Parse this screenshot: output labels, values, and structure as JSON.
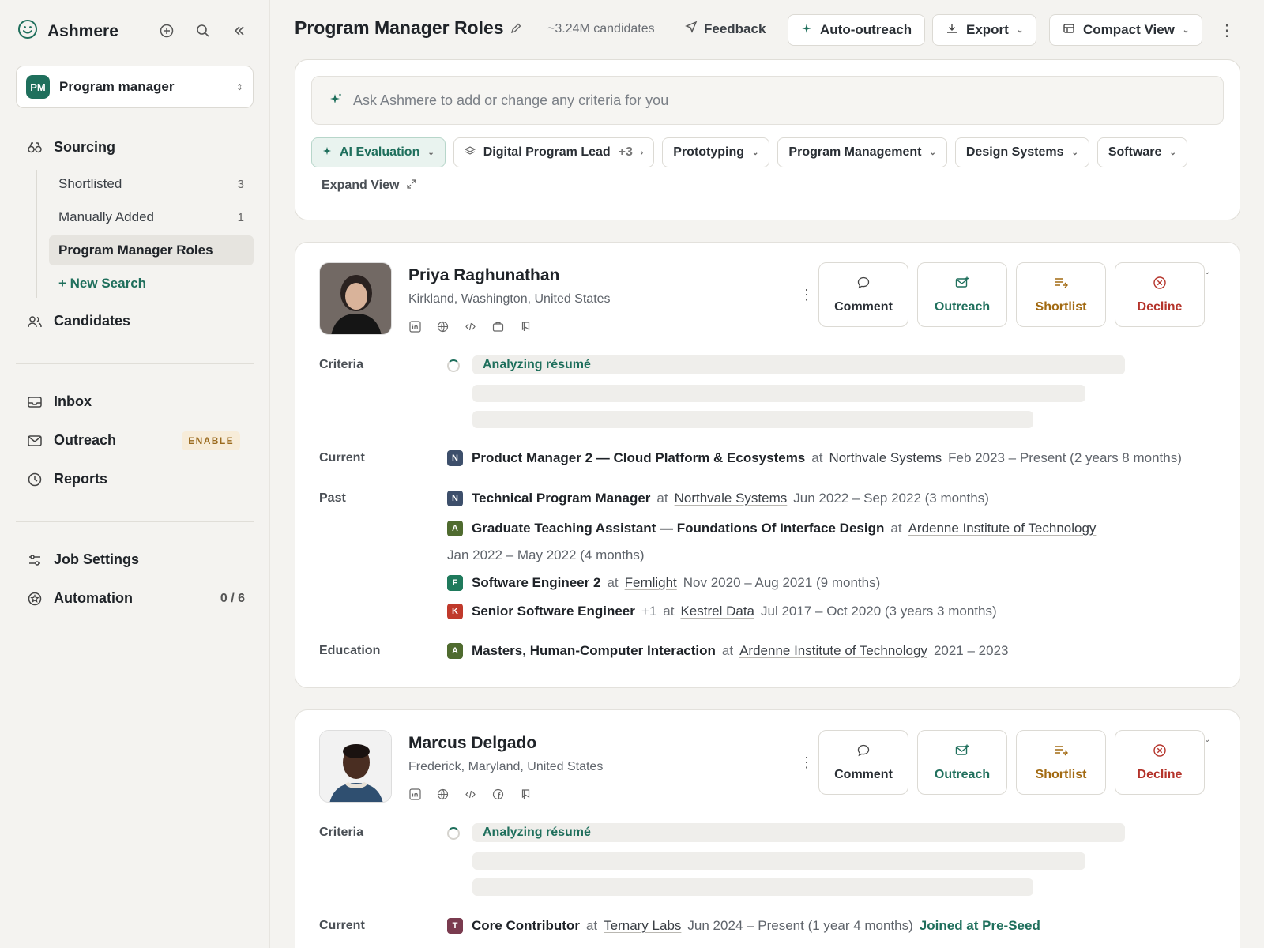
{
  "app": {
    "name": "Ashmere"
  },
  "project": {
    "badge": "PM",
    "name": "Program manager"
  },
  "sidebar": {
    "sourcing_label": "Sourcing",
    "sub_items": [
      {
        "label": "Shortlisted",
        "count": "3"
      },
      {
        "label": "Manually Added",
        "count": "1"
      },
      {
        "label": "Program Manager Roles",
        "count": ""
      },
      {
        "label": "+ New Search",
        "count": ""
      }
    ],
    "candidates_label": "Candidates",
    "inbox_label": "Inbox",
    "outreach_label": "Outreach",
    "outreach_badge": "ENABLE",
    "reports_label": "Reports",
    "job_settings_label": "Job Settings",
    "automation_label": "Automation",
    "automation_count": "0 / 6"
  },
  "topbar": {
    "title": "Program Manager Roles",
    "candidate_count": "~3.24M candidates",
    "feedback": "Feedback",
    "auto_outreach": "Auto-outreach",
    "export": "Export",
    "view": "Compact View"
  },
  "criteria_panel": {
    "ask_placeholder": "Ask Ashmere to add or change any criteria for you",
    "chips": [
      {
        "label": "AI Evaluation",
        "extra": ""
      },
      {
        "label": "Digital Program Lead",
        "extra": "+3"
      },
      {
        "label": "Prototyping",
        "extra": ""
      },
      {
        "label": "Program Management",
        "extra": ""
      },
      {
        "label": "Design Systems",
        "extra": ""
      },
      {
        "label": "Software",
        "extra": ""
      }
    ],
    "expand_view": "Expand View"
  },
  "actions": {
    "comment": "Comment",
    "outreach": "Outreach",
    "shortlist": "Shortlist",
    "decline": "Decline"
  },
  "labels": {
    "criteria": "Criteria",
    "current": "Current",
    "past": "Past",
    "education": "Education",
    "analyzing": "Analyzing résumé",
    "at": "at"
  },
  "candidates": [
    {
      "name": "Priya Raghunathan",
      "location": "Kirkland, Washington, United States",
      "current": {
        "logo": "N",
        "logo_color": "#3d4f6b",
        "role": "Product Manager 2 — Cloud Platform & Ecosystems",
        "company": "Northvale Systems",
        "dates": "Feb 2023 – Present (2 years 8 months)"
      },
      "past": [
        {
          "logo": "N",
          "logo_color": "#3d4f6b",
          "role": "Technical Program Manager",
          "extra": "",
          "company": "Northvale Systems",
          "dates": "Jun 2022 – Sep 2022 (3 months)"
        },
        {
          "logo": "A",
          "logo_color": "#4f6b2f",
          "role": "Graduate Teaching Assistant — Foundations Of Interface Design",
          "extra": "",
          "company": "Ardenne Institute of Technology",
          "dates": "Jan 2022 – May 2022 (4 months)"
        },
        {
          "logo": "F",
          "logo_color": "#1f7a5c",
          "role": "Software Engineer 2",
          "extra": "",
          "company": "Fernlight",
          "dates": "Nov 2020 – Aug 2021 (9 months)"
        },
        {
          "logo": "K",
          "logo_color": "#c0392b",
          "role": "Senior Software Engineer",
          "extra": "+1",
          "company": "Kestrel Data",
          "dates": "Jul 2017 – Oct 2020 (3 years 3 months)"
        }
      ],
      "education": {
        "logo": "A",
        "logo_color": "#4f6b2f",
        "degree": "Masters, Human-Computer Interaction",
        "school": "Ardenne Institute of Technology",
        "dates": "2021 – 2023"
      }
    },
    {
      "name": "Marcus Delgado",
      "location": "Frederick, Maryland, United States",
      "current": {
        "logo": "T",
        "logo_color": "#7a3b4f",
        "role": "Core Contributor",
        "company": "Ternary Labs",
        "dates": "Jun 2024 – Present (1 year 4 months)",
        "tag": "Joined at Pre-Seed"
      }
    }
  ],
  "colors": {
    "accent": "#1f6f5c",
    "shortlist": "#a26a12",
    "decline": "#b4332a",
    "background": "#f4f3f0"
  }
}
